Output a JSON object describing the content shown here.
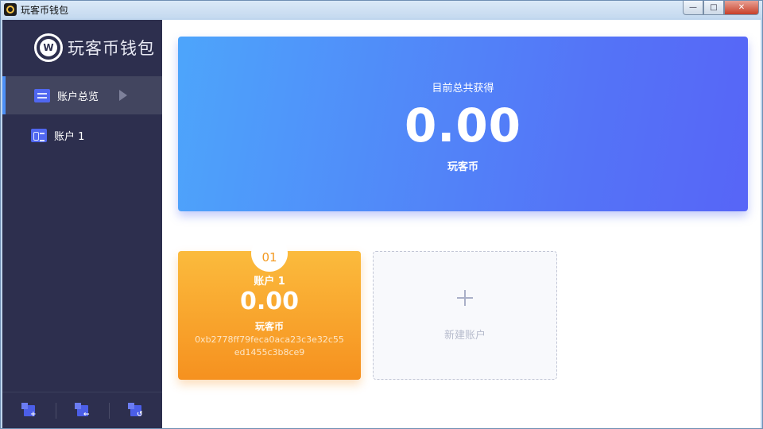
{
  "window": {
    "title": "玩客币钱包",
    "controls": {
      "minimize": "—",
      "maximize": "□",
      "close": "✕"
    }
  },
  "sidebar": {
    "logo_text": "玩客币钱包",
    "logo_mark": "W",
    "items": [
      {
        "label": "账户总览",
        "icon": "list-icon",
        "active": true
      },
      {
        "label": "账户 1",
        "icon": "id-card-icon",
        "active": false
      }
    ],
    "footer_buttons": [
      {
        "icon": "add-wallet-icon",
        "glyph": "+"
      },
      {
        "icon": "import-wallet-icon",
        "glyph": "←"
      },
      {
        "icon": "restore-wallet-icon",
        "glyph": "↺"
      }
    ]
  },
  "summary": {
    "label": "目前总共获得",
    "amount": "0.00",
    "unit": "玩客币"
  },
  "accounts": [
    {
      "index": "01",
      "name": "账户 1",
      "amount": "0.00",
      "unit": "玩客币",
      "address": "0xb2778ff79feca0aca23c3e32c55ed1455c3b8ce9"
    }
  ],
  "new_account": {
    "label": "新建账户"
  },
  "colors": {
    "sidebar_bg": "#2d2f4e",
    "accent_blue": "#5474f7",
    "accent_orange": "#f6911f"
  }
}
